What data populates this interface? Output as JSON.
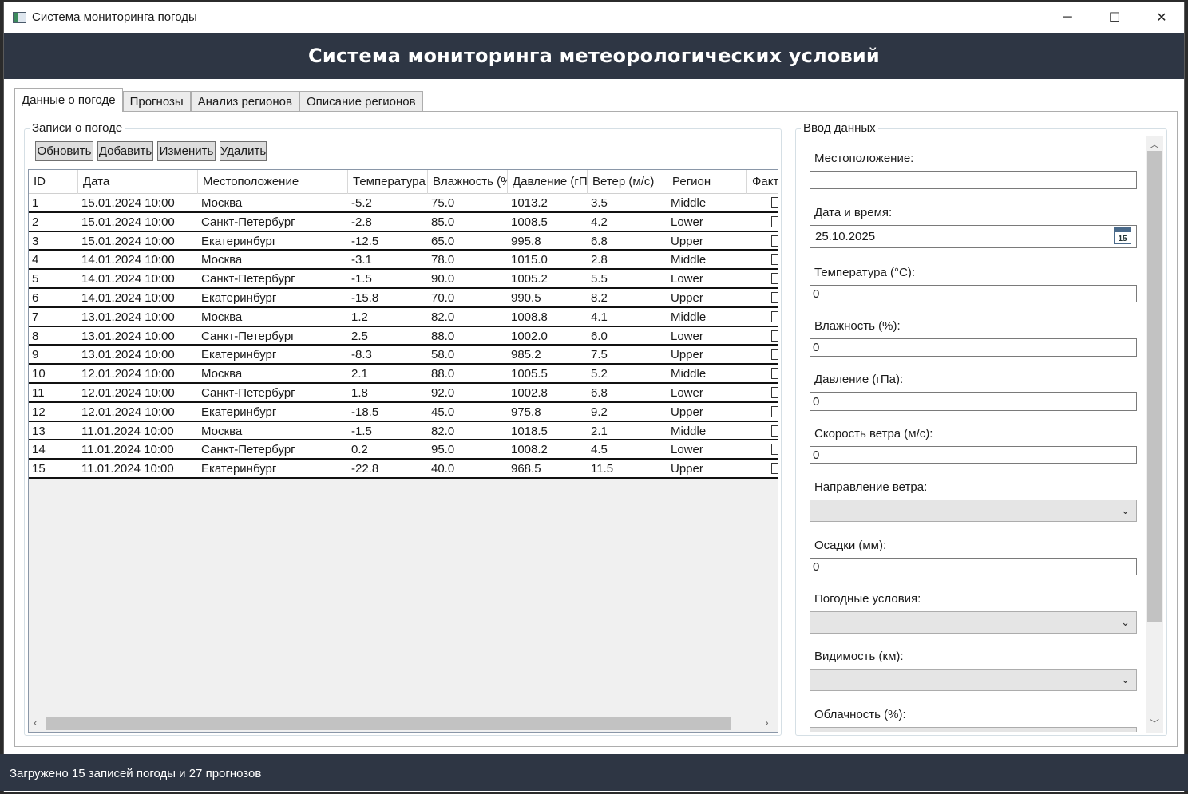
{
  "window": {
    "title": "Система мониторинга погоды",
    "minimize": "─",
    "maximize": "☐",
    "close": "✕"
  },
  "header": {
    "title": "Система мониторинга метеорологических условий"
  },
  "tabs": [
    {
      "label": "Данные о погоде"
    },
    {
      "label": "Прогнозы"
    },
    {
      "label": "Анализ регионов"
    },
    {
      "label": "Описание регионов"
    }
  ],
  "records": {
    "group_title": "Записи о погоде",
    "buttons": {
      "refresh": "Обновить",
      "add": "Добавить",
      "edit": "Изменить",
      "delete": "Удалить"
    },
    "columns": [
      "ID",
      "Дата",
      "Местоположение",
      "Температура",
      "Влажность (%",
      "Давление (гП",
      "Ветер (м/с)",
      "Регион",
      "Факт"
    ],
    "rows": [
      [
        "1",
        "15.01.2024 10:00",
        "Москва",
        "-5.2",
        "75.0",
        "1013.2",
        "3.5",
        "Middle"
      ],
      [
        "2",
        "15.01.2024 10:00",
        "Санкт-Петербург",
        "-2.8",
        "85.0",
        "1008.5",
        "4.2",
        "Lower"
      ],
      [
        "3",
        "15.01.2024 10:00",
        "Екатеринбург",
        "-12.5",
        "65.0",
        "995.8",
        "6.8",
        "Upper"
      ],
      [
        "4",
        "14.01.2024 10:00",
        "Москва",
        "-3.1",
        "78.0",
        "1015.0",
        "2.8",
        "Middle"
      ],
      [
        "5",
        "14.01.2024 10:00",
        "Санкт-Петербург",
        "-1.5",
        "90.0",
        "1005.2",
        "5.5",
        "Lower"
      ],
      [
        "6",
        "14.01.2024 10:00",
        "Екатеринбург",
        "-15.8",
        "70.0",
        "990.5",
        "8.2",
        "Upper"
      ],
      [
        "7",
        "13.01.2024 10:00",
        "Москва",
        "1.2",
        "82.0",
        "1008.8",
        "4.1",
        "Middle"
      ],
      [
        "8",
        "13.01.2024 10:00",
        "Санкт-Петербург",
        "2.5",
        "88.0",
        "1002.0",
        "6.0",
        "Lower"
      ],
      [
        "9",
        "13.01.2024 10:00",
        "Екатеринбург",
        "-8.3",
        "58.0",
        "985.2",
        "7.5",
        "Upper"
      ],
      [
        "10",
        "12.01.2024 10:00",
        "Москва",
        "2.1",
        "88.0",
        "1005.5",
        "5.2",
        "Middle"
      ],
      [
        "11",
        "12.01.2024 10:00",
        "Санкт-Петербург",
        "1.8",
        "92.0",
        "1002.8",
        "6.8",
        "Lower"
      ],
      [
        "12",
        "12.01.2024 10:00",
        "Екатеринбург",
        "-18.5",
        "45.0",
        "975.8",
        "9.2",
        "Upper"
      ],
      [
        "13",
        "11.01.2024 10:00",
        "Москва",
        "-1.5",
        "82.0",
        "1018.5",
        "2.1",
        "Middle"
      ],
      [
        "14",
        "11.01.2024 10:00",
        "Санкт-Петербург",
        "0.2",
        "95.0",
        "1008.2",
        "4.5",
        "Lower"
      ],
      [
        "15",
        "11.01.2024 10:00",
        "Екатеринбург",
        "-22.8",
        "40.0",
        "968.5",
        "11.5",
        "Upper"
      ]
    ],
    "scroll_left": "‹",
    "scroll_right": "›"
  },
  "input": {
    "group_title": "Ввод данных",
    "location_label": "Местоположение:",
    "location_value": "",
    "datetime_label": "Дата и время:",
    "datetime_value": "25.10.2025",
    "calendar_day": "15",
    "temperature_label": "Температура (°C):",
    "temperature_value": "0",
    "humidity_label": "Влажность (%):",
    "humidity_value": "0",
    "pressure_label": "Давление (гПа):",
    "pressure_value": "0",
    "wind_speed_label": "Скорость ветра (м/с):",
    "wind_speed_value": "0",
    "wind_direction_label": "Направление ветра:",
    "precipitation_label": "Осадки (мм):",
    "precipitation_value": "0",
    "conditions_label": "Погодные условия:",
    "visibility_label": "Видимость (км):",
    "cloudiness_label": "Облачность (%):",
    "combo_arrow": "⌄",
    "scroll_up": "︿",
    "scroll_down": "﹀"
  },
  "status": {
    "text": "Загружено 15 записей погоды и 27 прогнозов"
  }
}
